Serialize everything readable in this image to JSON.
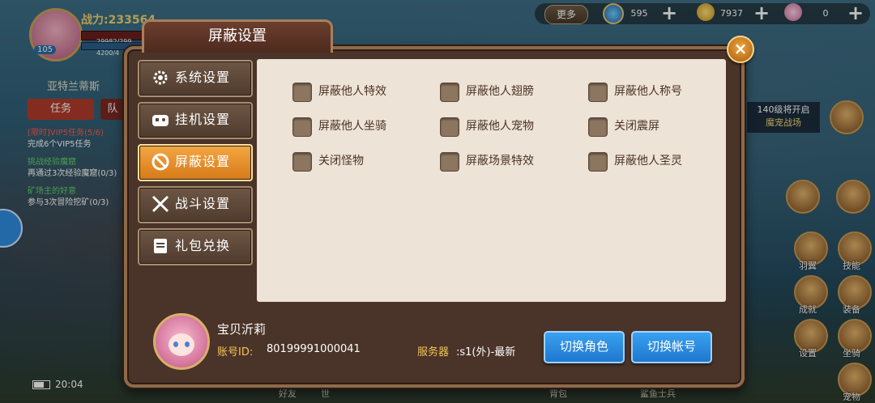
{
  "hud": {
    "player_level": "105",
    "power_label": "战力:233564",
    "hp_text": "29982/299",
    "mp_text": "4200/4",
    "location": "亚特兰蒂斯",
    "quest_tab": "任务",
    "quest_tab2": "队",
    "quests": [
      {
        "title": "[限时]VIP5任务(5/6)",
        "desc": "完成6个VIP5任务"
      },
      {
        "title": "挑战经验魔窟",
        "desc": "再通过3次经验魔窟(0/3)"
      },
      {
        "title": "矿场主的好意",
        "desc": "参与3次冒险挖矿(0/3)"
      }
    ],
    "time": "20:04",
    "bottom_labels": [
      "好友",
      "世",
      "背包",
      "鲨鱼士兵"
    ],
    "event_title": "140级将开启",
    "event_sub": "魔宠战场",
    "right_labels": [
      "羽翼",
      "技能",
      "成就",
      "装备",
      "设置",
      "坐骑",
      "宠物"
    ]
  },
  "resources": {
    "more_label": "更多",
    "gem_value": "595",
    "gold_value": "7937",
    "shell_value": "0",
    "plus": "+"
  },
  "modal": {
    "title": "屏蔽设置",
    "close": "×",
    "nav": [
      {
        "label": "系统设置",
        "icon": "gear-icon",
        "active": false
      },
      {
        "label": "挂机设置",
        "icon": "gamepad-icon",
        "active": false
      },
      {
        "label": "屏蔽设置",
        "icon": "block-icon",
        "active": true
      },
      {
        "label": "战斗设置",
        "icon": "crossed-swords-icon",
        "active": false
      },
      {
        "label": "礼包兑换",
        "icon": "gift-note-icon",
        "active": false
      }
    ],
    "options": [
      [
        "屏蔽他人特效",
        "屏蔽他人翅膀",
        "屏蔽他人称号"
      ],
      [
        "屏蔽他人坐骑",
        "屏蔽他人宠物",
        "关闭震屏"
      ],
      [
        "关闭怪物",
        "屏蔽场景特效",
        "屏蔽他人圣灵"
      ]
    ],
    "player": {
      "name": "宝贝沂莉",
      "account_label": "账号ID:",
      "account_id": "80199991000041",
      "server_label": "服务器",
      "server_value": ":s1(外)-最新"
    },
    "buttons": {
      "switch_role": "切换角色",
      "switch_account": "切换帐号"
    }
  },
  "colors": {
    "accent_orange": "#e38a25",
    "blue_button": "#2a8be0",
    "panel_bg": "#ede3d6",
    "frame": "#4a3328"
  }
}
